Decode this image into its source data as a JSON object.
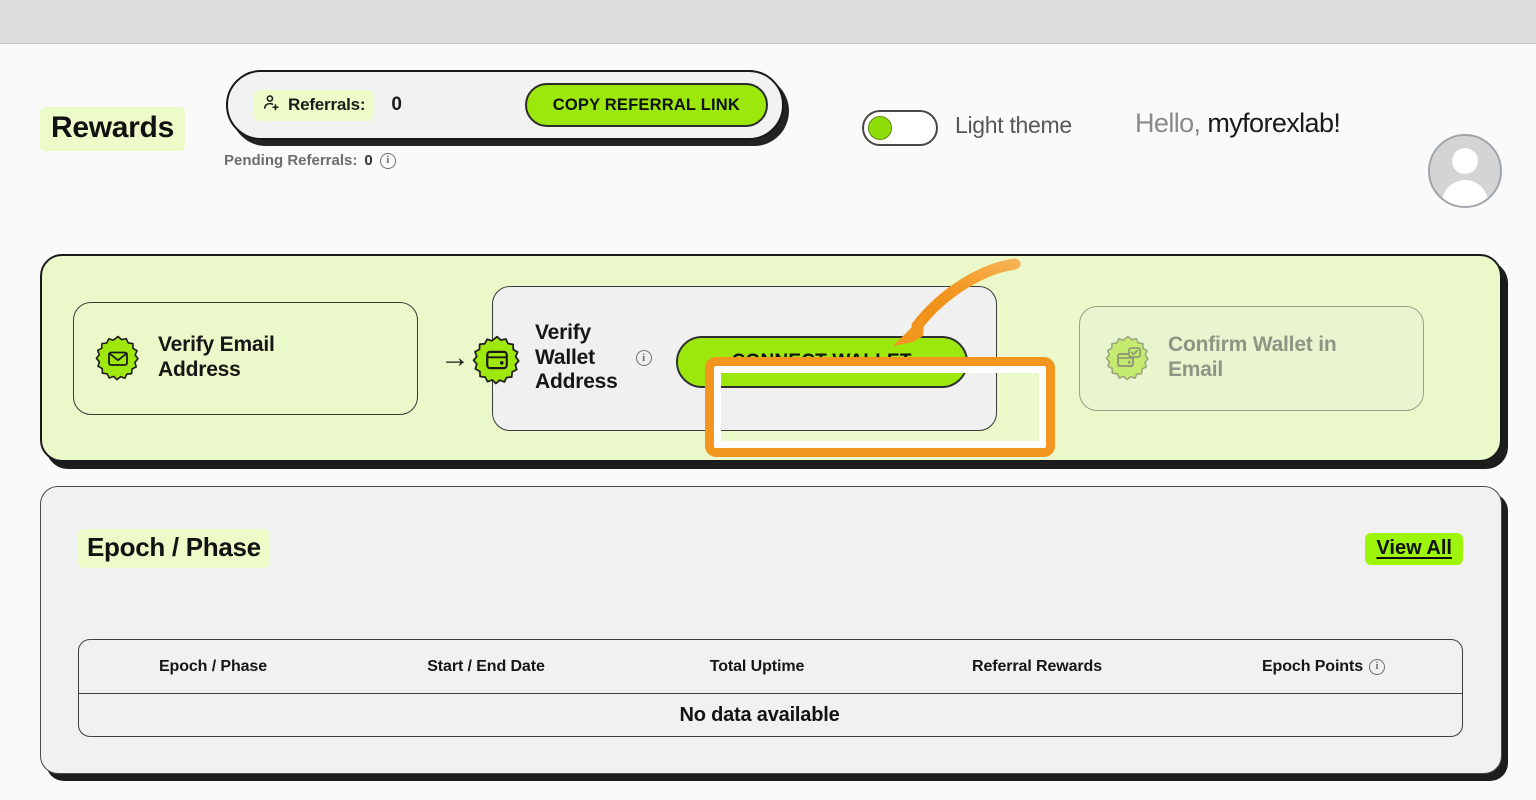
{
  "header": {
    "page_title": "Rewards",
    "referrals_label": "Referrals:",
    "referrals_count": "0",
    "referrals_icon": "person-add-icon",
    "copy_referral_label": "COPY REFERRAL LINK",
    "pending_referrals_label": "Pending Referrals:",
    "pending_referrals_count": "0",
    "pending_info_icon": "info-icon",
    "theme_label": "Light theme",
    "theme_toggle_state": "off",
    "greeting_prefix": "Hello,",
    "greeting_user": "myforexlab!",
    "avatar_icon": "user-avatar-icon"
  },
  "steps": {
    "arrow_glyph": "→",
    "items": [
      {
        "label": "Verify Email\nAddress",
        "icon": "email-badge-icon",
        "state": "active"
      },
      {
        "label": "Verify\nWallet\nAddress",
        "icon": "wallet-badge-icon",
        "state": "current",
        "info_icon": "info-icon",
        "action_label": "CONNECT WALLET"
      },
      {
        "label": "Confirm Wallet in\nEmail",
        "icon": "wallet-check-badge-icon",
        "state": "disabled"
      }
    ]
  },
  "annotation": {
    "highlight_target": "connect-wallet-button",
    "highlight_color": "#f2961f",
    "arrow_color": "#f2961f"
  },
  "epoch": {
    "title": "Epoch / Phase",
    "view_all_label": "View All",
    "columns": [
      "Epoch / Phase",
      "Start / End Date",
      "Total Uptime",
      "Referral Rewards",
      "Epoch Points"
    ],
    "epoch_points_info_icon": "info-icon",
    "empty_message": "No data available",
    "rows": []
  },
  "colors": {
    "accent_green": "#9ce80d",
    "panel_green": "#ebf9ca",
    "highlight_chip": "#edfbc8",
    "view_all_green": "#9ef50c",
    "annotation_orange": "#f2961f",
    "page_bg": "#fafafa",
    "browser_strip": "#dcdcdc"
  }
}
